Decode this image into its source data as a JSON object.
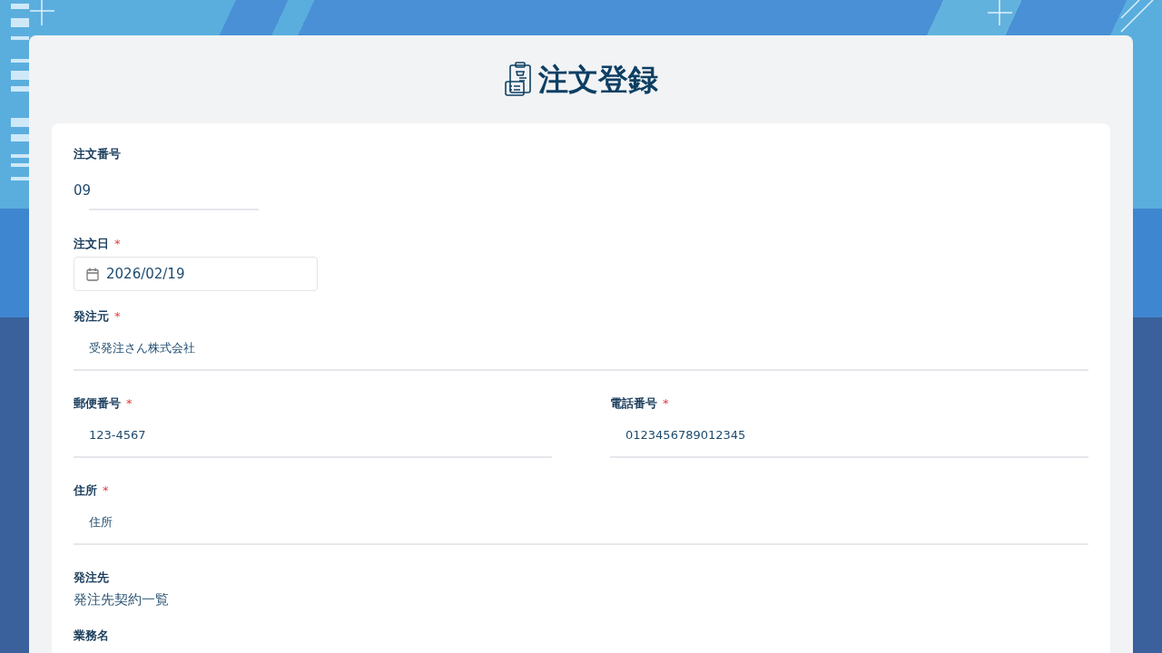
{
  "page": {
    "title": "注文登録"
  },
  "form": {
    "rows": [
      {
        "fields": [
          {
            "label": "注文番号",
            "kind": "number",
            "value": "09"
          }
        ]
      },
      {
        "fields": [
          {
            "label": "注文日",
            "required_mark": "*",
            "kind": "date",
            "value": "2026/02/19"
          }
        ]
      },
      {
        "fields": [
          {
            "label": "発注元",
            "required_mark": "*",
            "kind": "text",
            "value": "受発注さん株式会社"
          }
        ]
      },
      {
        "fields": [
          {
            "label": "郵便番号",
            "required_mark": "*",
            "kind": "text",
            "value": "123-4567"
          },
          {
            "label": "電話番号",
            "required_mark": "*",
            "kind": "text",
            "value": "0123456789012345"
          }
        ]
      },
      {
        "fields": [
          {
            "label": "住所",
            "required_mark": "*",
            "kind": "text",
            "value": "住所"
          }
        ]
      },
      {
        "fields": [
          {
            "label": "発注先",
            "kind": "static",
            "value": "発注先契約一覧"
          }
        ]
      },
      {
        "fields": [
          {
            "label": "業務名",
            "kind": "label_only"
          }
        ]
      }
    ]
  }
}
